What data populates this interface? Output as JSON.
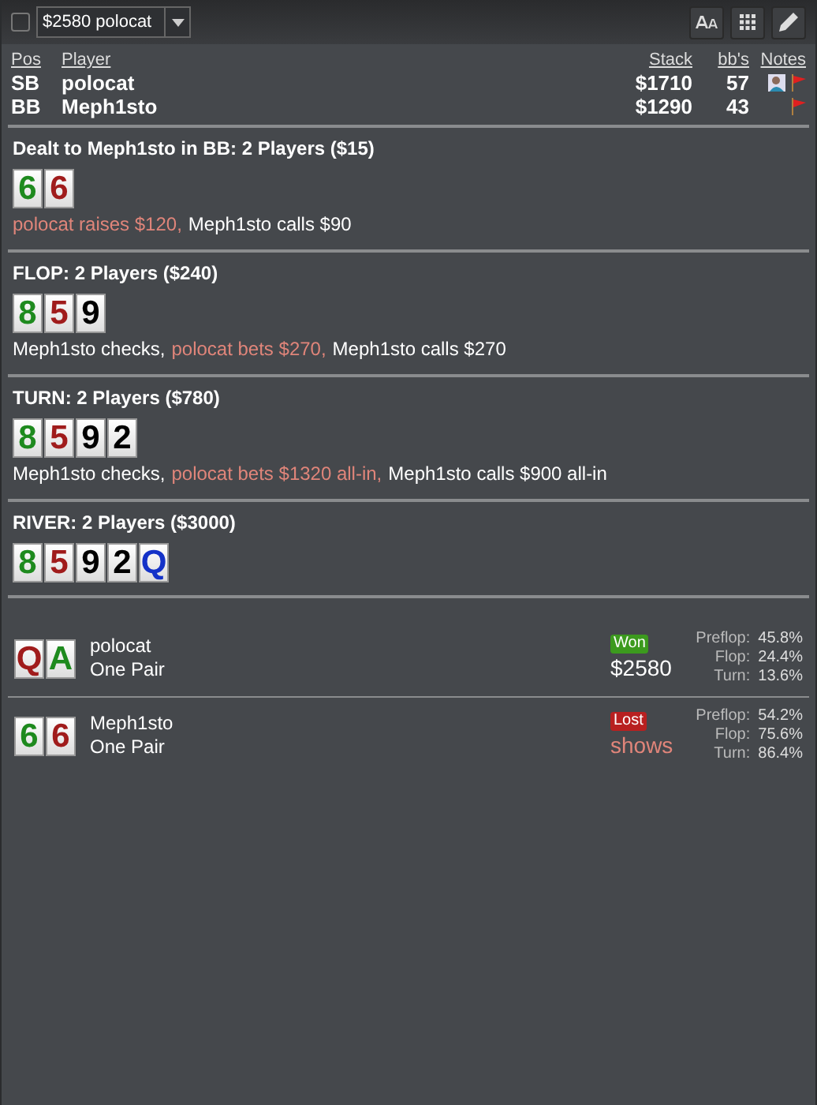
{
  "toolbar": {
    "checkbox": {
      "checked": false
    },
    "hand_select": {
      "value": "$2580 polocat"
    }
  },
  "players_table": {
    "columns": [
      "Pos",
      "Player",
      "Stack",
      "bb's",
      "Notes"
    ],
    "rows": [
      {
        "pos": "SB",
        "player": "polocat",
        "stack": "$1710",
        "bbs": "57",
        "notes": [
          {
            "kind": "person"
          },
          {
            "kind": "flag"
          }
        ]
      },
      {
        "pos": "BB",
        "player": "Meph1sto",
        "stack": "$1290",
        "bbs": "43",
        "notes": [
          {
            "kind": "flag"
          }
        ]
      }
    ]
  },
  "streets": [
    {
      "title": "Dealt to Meph1sto in BB: 2 Players ($15)",
      "cards": [
        {
          "rank": "6",
          "color": "#1e8a1e"
        },
        {
          "rank": "6",
          "color": "#a01c1c"
        }
      ],
      "actions": [
        {
          "text": "polocat raises $120,",
          "highlight": true
        },
        {
          "text": "Meph1sto calls $90",
          "highlight": false
        }
      ]
    },
    {
      "title": "FLOP: 2 Players ($240)",
      "cards": [
        {
          "rank": "8",
          "color": "#1e8a1e"
        },
        {
          "rank": "5",
          "color": "#a01c1c"
        },
        {
          "rank": "9",
          "color": "#000000"
        }
      ],
      "actions": [
        {
          "text": "Meph1sto checks,",
          "highlight": false
        },
        {
          "text": "polocat bets $270,",
          "highlight": true
        },
        {
          "text": "Meph1sto calls $270",
          "highlight": false
        }
      ]
    },
    {
      "title": "TURN: 2 Players ($780)",
      "cards": [
        {
          "rank": "8",
          "color": "#1e8a1e"
        },
        {
          "rank": "5",
          "color": "#a01c1c"
        },
        {
          "rank": "9",
          "color": "#000000"
        },
        {
          "rank": "2",
          "color": "#000000"
        }
      ],
      "actions": [
        {
          "text": "Meph1sto checks,",
          "highlight": false
        },
        {
          "text": "polocat bets $1320 all-in,",
          "highlight": true
        },
        {
          "text": "Meph1sto calls $900 all-in",
          "highlight": false
        }
      ]
    },
    {
      "title": "RIVER: 2 Players ($3000)",
      "cards": [
        {
          "rank": "8",
          "color": "#1e8a1e"
        },
        {
          "rank": "5",
          "color": "#a01c1c"
        },
        {
          "rank": "9",
          "color": "#000000"
        },
        {
          "rank": "2",
          "color": "#000000"
        },
        {
          "rank": "Q",
          "color": "#1432c8"
        }
      ]
    }
  ],
  "showdown": [
    {
      "cards": [
        {
          "rank": "Q",
          "color": "#a01c1c"
        },
        {
          "rank": "A",
          "color": "#1e8a1e"
        }
      ],
      "player": "polocat",
      "hand": "One Pair",
      "result": {
        "kind": "won",
        "badge": "Won",
        "amount": "$2580"
      },
      "equity": [
        {
          "street": "Preflop:",
          "value": "45.8%"
        },
        {
          "street": "Flop:",
          "value": "24.4%"
        },
        {
          "street": "Turn:",
          "value": "13.6%"
        }
      ]
    },
    {
      "cards": [
        {
          "rank": "6",
          "color": "#1e8a1e"
        },
        {
          "rank": "6",
          "color": "#a01c1c"
        }
      ],
      "player": "Meph1sto",
      "hand": "One Pair",
      "result": {
        "kind": "lost",
        "badge": "Lost",
        "amount": "shows"
      },
      "equity": [
        {
          "street": "Preflop:",
          "value": "54.2%"
        },
        {
          "street": "Flop:",
          "value": "75.6%"
        },
        {
          "street": "Turn:",
          "value": "86.4%"
        }
      ]
    }
  ]
}
